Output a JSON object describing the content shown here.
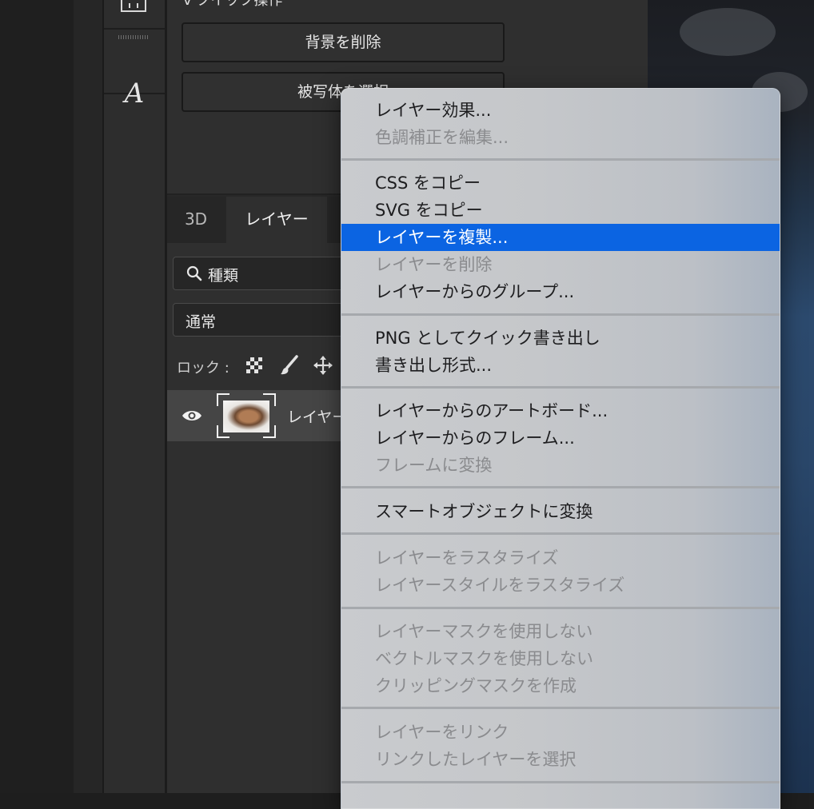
{
  "quick_actions": {
    "section_title": "v クイック操作",
    "remove_bg_label": "背景を削除",
    "select_subject_label": "被写体を選択"
  },
  "layers_panel": {
    "tab_3d": "3D",
    "tab_layers": "レイヤー",
    "search_placeholder": "種類",
    "blend_mode": "通常",
    "lock_label": "ロック :",
    "layer_name": "レイヤー"
  },
  "context_menu": {
    "items": [
      {
        "label": "レイヤー効果...",
        "enabled": true
      },
      {
        "label": "色調補正を編集...",
        "enabled": false
      },
      {
        "label": "CSS をコピー",
        "enabled": true
      },
      {
        "label": "SVG をコピー",
        "enabled": true
      },
      {
        "label": "レイヤーを複製...",
        "enabled": true,
        "selected": true
      },
      {
        "label": "レイヤーを削除",
        "enabled": false
      },
      {
        "label": "レイヤーからのグループ...",
        "enabled": true
      },
      {
        "label": "PNG としてクイック書き出し",
        "enabled": true
      },
      {
        "label": "書き出し形式...",
        "enabled": true
      },
      {
        "label": "レイヤーからのアートボード...",
        "enabled": true
      },
      {
        "label": "レイヤーからのフレーム...",
        "enabled": true
      },
      {
        "label": "フレームに変換",
        "enabled": false
      },
      {
        "label": "スマートオブジェクトに変換",
        "enabled": true
      },
      {
        "label": "レイヤーをラスタライズ",
        "enabled": false
      },
      {
        "label": "レイヤースタイルをラスタライズ",
        "enabled": false
      },
      {
        "label": "レイヤーマスクを使用しない",
        "enabled": false
      },
      {
        "label": "ベクトルマスクを使用しない",
        "enabled": false
      },
      {
        "label": "クリッピングマスクを作成",
        "enabled": false
      },
      {
        "label": "レイヤーをリンク",
        "enabled": false
      },
      {
        "label": "リンクしたレイヤーを選択",
        "enabled": false
      }
    ]
  },
  "colors": {
    "menu_highlight": "#0b64e2",
    "panel_bg": "#2f2f2f",
    "disabled_text": "#8a8b8e"
  },
  "icons": [
    "frame-tool-icon",
    "type-tool-icon",
    "search-icon",
    "lock-transparency-icon",
    "lock-paint-icon",
    "lock-position-icon",
    "eye-icon"
  ]
}
